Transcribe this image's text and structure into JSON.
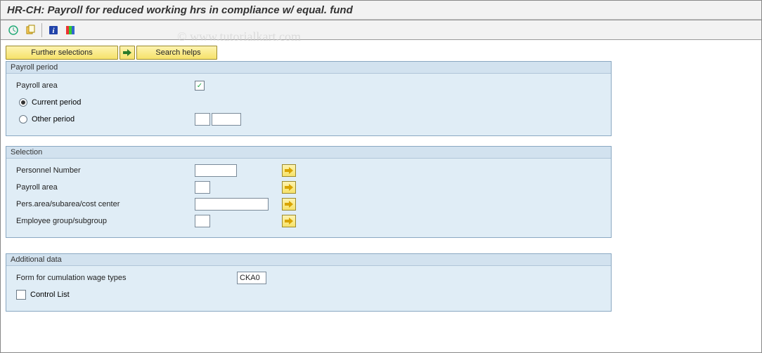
{
  "title": "HR-CH: Payroll for reduced working hrs in compliance w/ equal. fund",
  "watermark": "© www.tutorialkart.com",
  "toolbar": {
    "icons": [
      "execute-icon",
      "get-variant-icon",
      "info-icon",
      "color-legend-icon"
    ]
  },
  "buttons": {
    "further_selections": "Further selections",
    "search_helps": "Search helps"
  },
  "groups": {
    "payroll_period": {
      "title": "Payroll period",
      "payroll_area_label": "Payroll area",
      "payroll_area_checked": true,
      "current_label": "Current period",
      "other_label": "Other period",
      "selected": "current",
      "other_value1": "",
      "other_value2": ""
    },
    "selection": {
      "title": "Selection",
      "rows": [
        {
          "label": "Personnel Number",
          "value": "",
          "width": "w60",
          "more": true
        },
        {
          "label": "Payroll area",
          "value": "",
          "width": "w20",
          "more": true
        },
        {
          "label": "Pers.area/subarea/cost center",
          "value": "",
          "width": "w105",
          "more": true
        },
        {
          "label": "Employee group/subgroup",
          "value": "",
          "width": "w20",
          "more": true
        }
      ]
    },
    "additional": {
      "title": "Additional data",
      "form_label": "Form for cumulation wage types",
      "form_value": "CKA0",
      "control_label": "Control List",
      "control_checked": false
    }
  }
}
